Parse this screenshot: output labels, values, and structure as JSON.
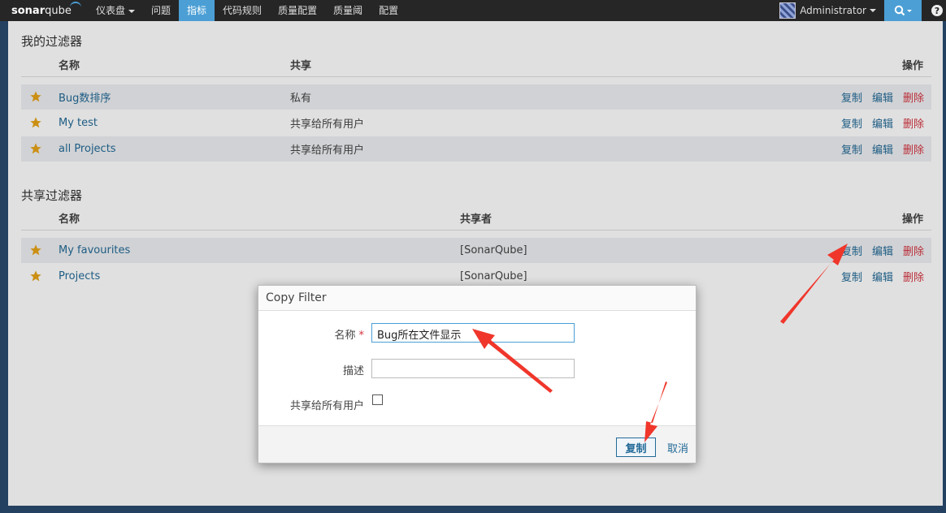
{
  "navbar": {
    "logo_main": "sonar",
    "logo_q": "qube",
    "items": [
      "仪表盘",
      "问题",
      "指标",
      "代码规则",
      "质量配置",
      "质量阈",
      "配置"
    ],
    "active_index": 2,
    "user": "Administrator"
  },
  "my_filters": {
    "title": "我的过滤器",
    "col_name": "名称",
    "col_share": "共享",
    "col_actions": "操作",
    "rows": [
      {
        "name": "Bug数排序",
        "share": "私有"
      },
      {
        "name": "My test",
        "share": "共享给所有用户"
      },
      {
        "name": "all Projects",
        "share": "共享给所有用户"
      }
    ]
  },
  "shared_filters": {
    "title": "共享过滤器",
    "col_name": "名称",
    "col_sharer": "共享者",
    "col_actions": "操作",
    "rows": [
      {
        "name": "My favourites",
        "sharer": "[SonarQube]"
      },
      {
        "name": "Projects",
        "sharer": "[SonarQube]"
      }
    ]
  },
  "actions": {
    "copy": "复制",
    "edit": "编辑",
    "delete": "删除"
  },
  "modal": {
    "title": "Copy Filter",
    "name_label": "名称",
    "required_mark": "*",
    "name_value": "Bug所在文件显示",
    "desc_label": "描述",
    "desc_value": "",
    "share_label": "共享给所有用户",
    "share_checked": false,
    "submit_label": "复制",
    "cancel_label": "取消"
  },
  "colors": {
    "accent": "#4b9fd5",
    "link": "#236a97",
    "danger": "#d4333f",
    "star": "#e8a317",
    "annotation": "#f0362b"
  }
}
